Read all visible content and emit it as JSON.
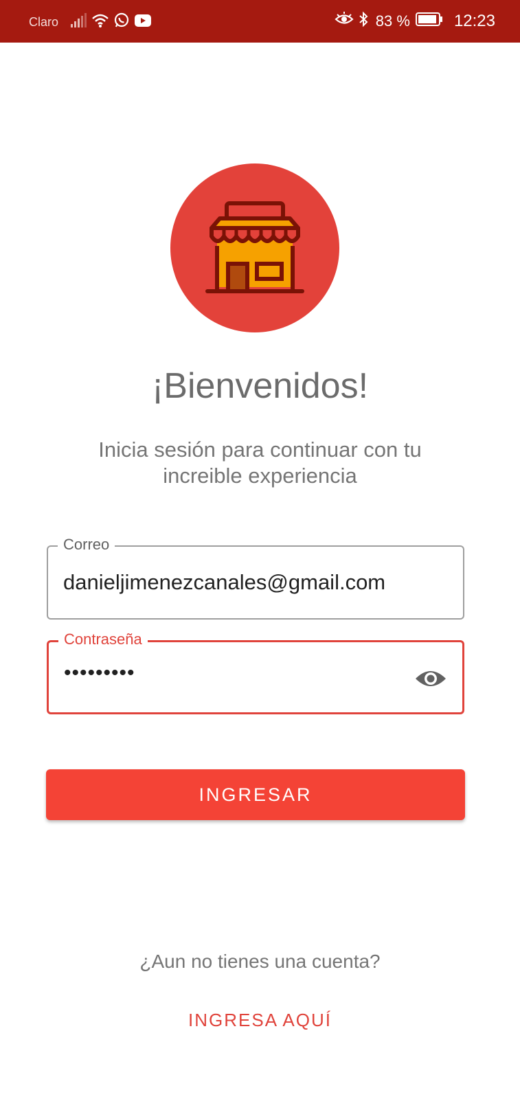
{
  "status_bar": {
    "carrier": "Claro",
    "battery": "83 %",
    "time": "12:23",
    "icons": [
      "signal-icon",
      "wifi-icon",
      "whatsapp-icon",
      "youtube-icon",
      "eye-comfort-icon",
      "bluetooth-icon",
      "battery-icon"
    ]
  },
  "header": {
    "logo": "store-icon",
    "title": "¡Bienvenidos!",
    "subtitle": "Inicia sesión para continuar con tu increible experiencia"
  },
  "form": {
    "email_label": "Correo",
    "email_value": "danieljimenezcanales@gmail.com",
    "password_label": "Contraseña",
    "password_value": "•••••••••",
    "password_toggle_icon": "eye-icon",
    "submit_label": "INGRESAR"
  },
  "footer": {
    "question": "¿Aun no tienes una cuenta?",
    "register_link": "INGRESA AQUÍ"
  },
  "colors": {
    "status_bar": "#a51a10",
    "accent": "#f44336",
    "logo_circle": "#e3423a",
    "text_gray": "#757575"
  }
}
